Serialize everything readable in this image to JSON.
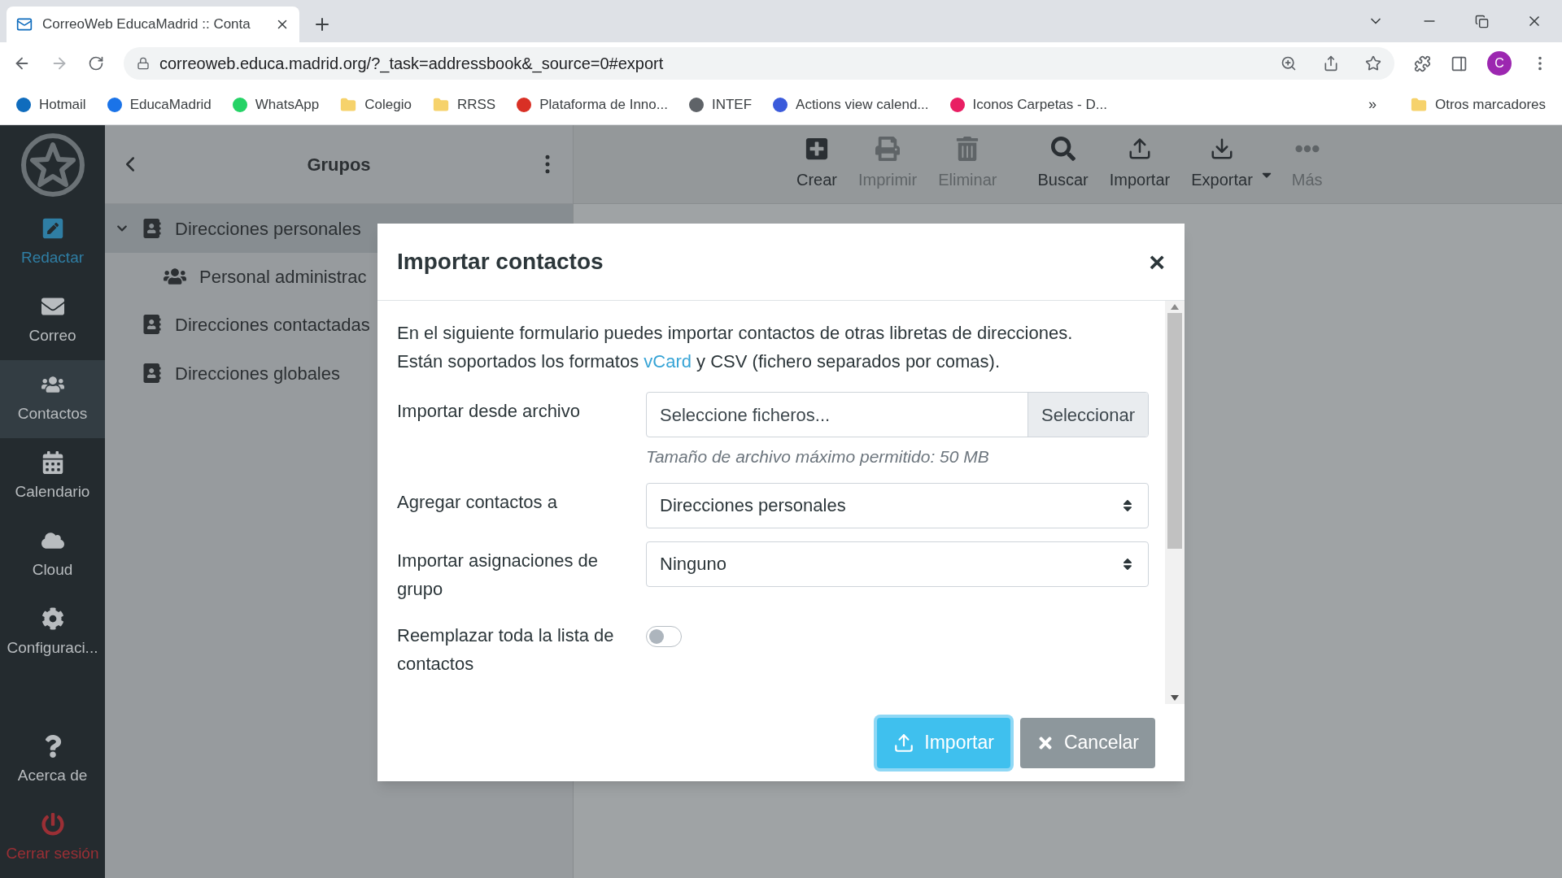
{
  "browser": {
    "tab_title": "CorreoWeb EducaMadrid :: Conta",
    "url": "correoweb.educa.madrid.org/?_task=addressbook&_source=0#export",
    "profile": "C",
    "bookmarks": [
      {
        "label": "Hotmail"
      },
      {
        "label": "EducaMadrid"
      },
      {
        "label": "WhatsApp"
      },
      {
        "label": "Colegio"
      },
      {
        "label": "RRSS"
      },
      {
        "label": "Plataforma de Inno..."
      },
      {
        "label": "INTEF"
      },
      {
        "label": "Actions view calend..."
      },
      {
        "label": "Iconos Carpetas - D..."
      }
    ],
    "overflow": "»",
    "other_bookmarks": "Otros marcadores"
  },
  "sidebar": {
    "items": [
      {
        "label": "Redactar",
        "kind": "compose",
        "selected": false
      },
      {
        "label": "Correo",
        "kind": "nav",
        "selected": false
      },
      {
        "label": "Contactos",
        "kind": "nav",
        "selected": true
      },
      {
        "label": "Calendario",
        "kind": "nav",
        "selected": false
      },
      {
        "label": "Cloud",
        "kind": "nav",
        "selected": false
      },
      {
        "label": "Configuraci...",
        "kind": "nav",
        "selected": false
      },
      {
        "label": "Acerca de",
        "kind": "nav",
        "selected": false
      },
      {
        "label": "Cerrar sesión",
        "kind": "logout",
        "selected": false
      }
    ]
  },
  "groups": {
    "title": "Grupos",
    "items": [
      {
        "label": "Direcciones personales",
        "expanded": true,
        "selected": true,
        "children": [
          {
            "label": "Personal administrac"
          }
        ]
      },
      {
        "label": "Direcciones contactadas",
        "selected": false
      },
      {
        "label": "Direcciones globales",
        "selected": false
      }
    ]
  },
  "toolbar": {
    "buttons": [
      {
        "label": "Crear",
        "disabled": false
      },
      {
        "label": "Imprimir",
        "disabled": true
      },
      {
        "label": "Eliminar",
        "disabled": true
      },
      {
        "label": "Buscar",
        "disabled": false
      },
      {
        "label": "Importar",
        "disabled": false
      },
      {
        "label": "Exportar",
        "disabled": false
      },
      {
        "label": "Más",
        "disabled": true
      }
    ]
  },
  "dialog": {
    "title": "Importar contactos",
    "close": "×",
    "intro": {
      "before": "En el siguiente formulario puedes importar contactos de otras libretas de direcciones. Están soportados los formatos",
      "link": "vCard",
      "after": "y CSV (fichero separados por comas)."
    },
    "fields": [
      {
        "kind": "file",
        "label": "Importar desde archivo",
        "placeholder": "Seleccione ficheros...",
        "button": "Seleccionar",
        "hint": "Tamaño de archivo máximo permitido: 50 MB"
      },
      {
        "kind": "select",
        "label": "Agregar contactos a",
        "value": "Direcciones personales"
      },
      {
        "kind": "select",
        "label": "Importar asignaciones de grupo",
        "value": "Ninguno"
      },
      {
        "kind": "toggle",
        "label": "Reemplazar toda la lista de contactos",
        "on": false
      }
    ],
    "buttons": [
      {
        "label": "Importar",
        "kind": "primary"
      },
      {
        "label": "Cancelar",
        "kind": "secondary"
      }
    ]
  }
}
